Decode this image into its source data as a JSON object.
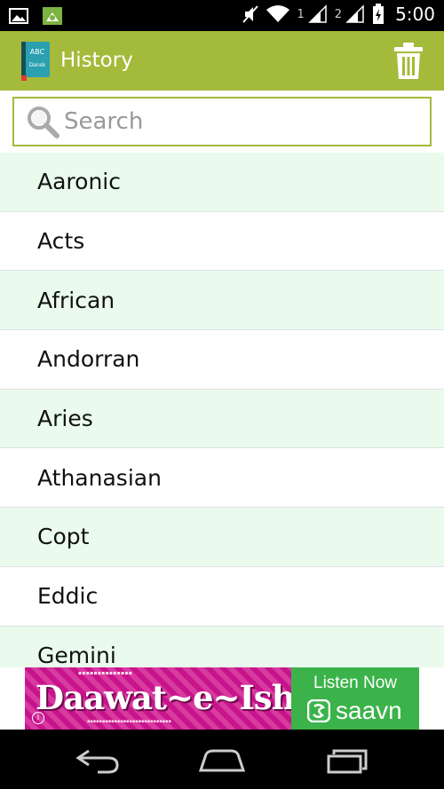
{
  "status_bar": {
    "time": "5:00",
    "sim1": "1",
    "sim2": "2",
    "icons": [
      "picture-icon",
      "android-icon",
      "mute-icon",
      "wifi-icon",
      "signal-icon",
      "signal-icon",
      "battery-icon"
    ]
  },
  "action_bar": {
    "title": "History",
    "app_icon_text_top": "ABC",
    "app_icon_text_bottom": "Dansk",
    "color": "#a4ba3a"
  },
  "search": {
    "placeholder": "Search",
    "value": ""
  },
  "history": {
    "items": [
      "Aaronic",
      "Acts",
      "African",
      "Andorran",
      "Aries",
      "Athanasian",
      "Copt",
      "Eddic",
      "Gemini"
    ]
  },
  "ad": {
    "title": "Daawat~e~Ishq",
    "cta": "Listen Now",
    "brand": "saavn",
    "info": "i"
  },
  "nav_bar": {
    "icons": [
      "back-icon",
      "home-icon",
      "recent-apps-icon"
    ]
  }
}
